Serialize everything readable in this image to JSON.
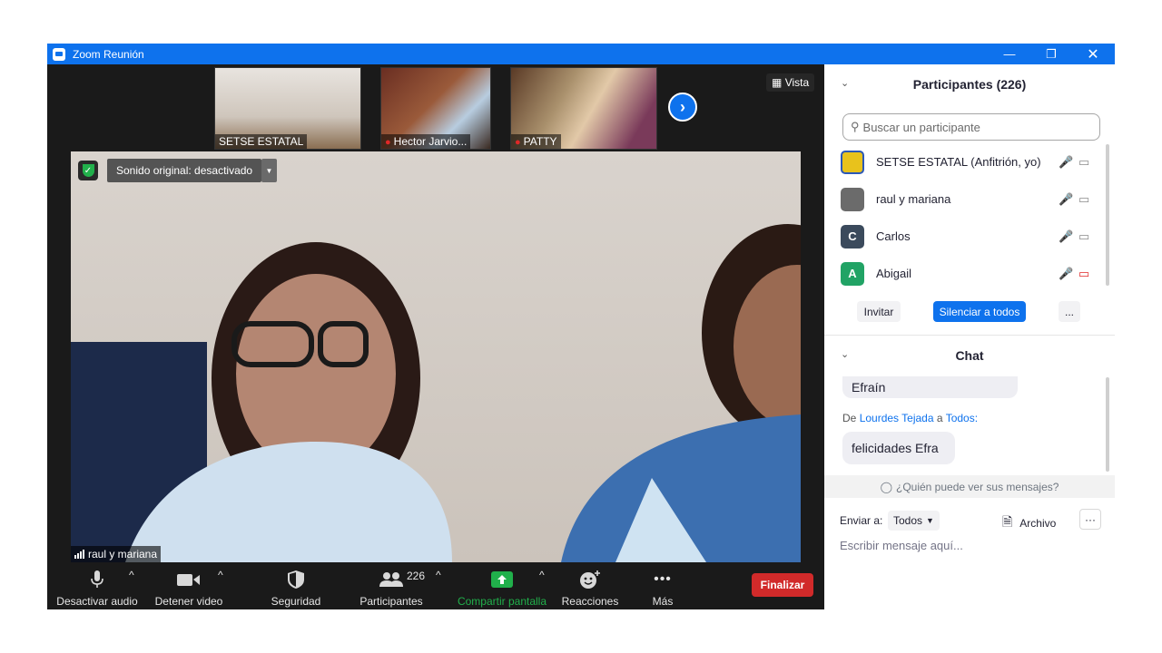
{
  "window": {
    "title": "Zoom Reunión"
  },
  "gallery": {
    "thumbs": [
      {
        "name": "SETSE ESTATAL",
        "muted": false
      },
      {
        "name": "Hector Jarvio...",
        "muted": true
      },
      {
        "name": "PATTY",
        "muted": true
      }
    ],
    "view_label": "Vista"
  },
  "main_video": {
    "original_sound": "Sonido original: desactivado",
    "speaker_name": "raul y mariana"
  },
  "toolbar": {
    "audio": "Desactivar audio",
    "video": "Detener video",
    "security": "Seguridad",
    "participants": "Participantes",
    "participants_count": "226",
    "share": "Compartir pantalla",
    "reactions": "Reacciones",
    "more": "Más",
    "end": "Finalizar"
  },
  "participants_panel": {
    "title": "Participantes (226)",
    "search_placeholder": "Buscar un participante",
    "list": [
      {
        "name": "SETSE ESTATAL (Anfitrión, yo)",
        "avatar": "",
        "avatar_color": "#e8c21c",
        "mic_muted": false,
        "cam_muted": false
      },
      {
        "name": "raul y mariana",
        "avatar": "",
        "avatar_color": "#6b6b6b",
        "mic_muted": false,
        "cam_muted": false
      },
      {
        "name": "Carlos",
        "avatar": "C",
        "avatar_color": "#3b4a5c",
        "mic_muted": false,
        "cam_muted": false
      },
      {
        "name": "Abigail",
        "avatar": "A",
        "avatar_color": "#21a365",
        "mic_muted": true,
        "cam_muted": true
      }
    ],
    "invite": "Invitar",
    "mute_all": "Silenciar a todos",
    "more": "..."
  },
  "chat": {
    "title": "Chat",
    "prev_message": "Efraín",
    "from_prefix": "De",
    "from_name": "Lourdes Tejada",
    "to_word": "a",
    "to_name": "Todos:",
    "message": "felicidades Efra",
    "who_can_see": "¿Quién puede ver sus mensajes?",
    "send_to_label": "Enviar a:",
    "send_to_value": "Todos",
    "file_label": "Archivo",
    "more": "···",
    "input_placeholder": "Escribir mensaje aquí..."
  },
  "colors": {
    "zoom_blue": "#0e72ed",
    "end_red": "#d12a2a",
    "share_green": "#21b04b"
  }
}
